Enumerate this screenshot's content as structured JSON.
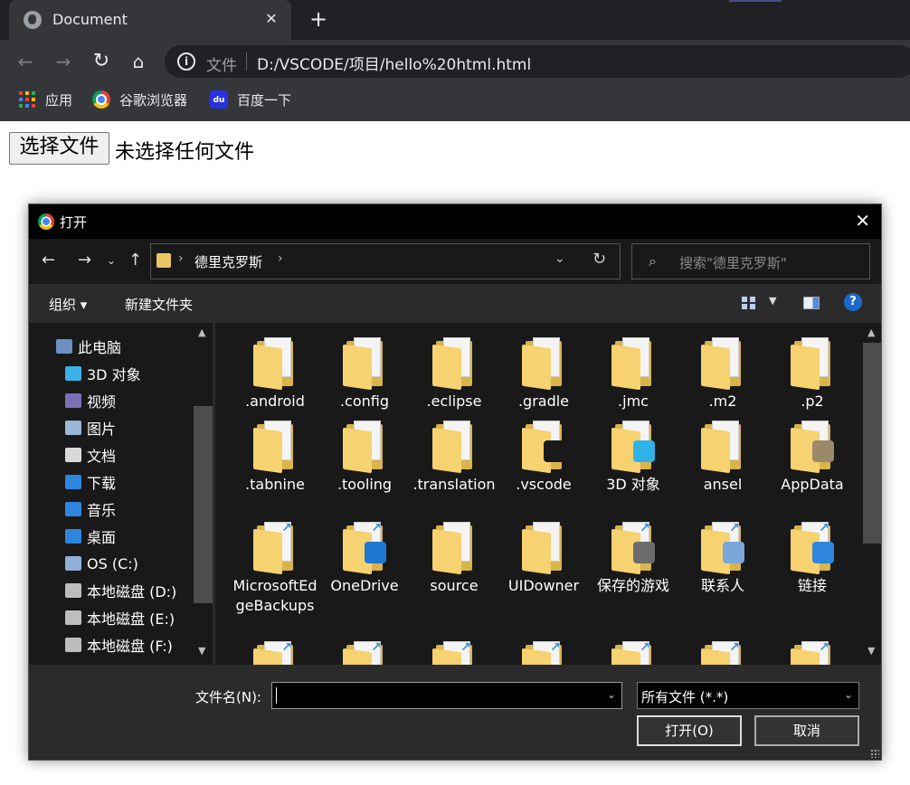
{
  "browser": {
    "tab_title": "Document",
    "tab_close": "✕",
    "new_tab": "+",
    "omnibox": {
      "scheme": "文件",
      "url": "D:/VSCODE/项目/hello%20html.html"
    },
    "bookmarks": [
      {
        "label": "应用",
        "icon": "apps-icon"
      },
      {
        "label": "谷歌浏览器",
        "icon": "chrome-icon"
      },
      {
        "label": "百度一下",
        "icon": "baidu-icon"
      }
    ]
  },
  "page": {
    "file_button": "选择文件",
    "file_status": "未选择任何文件"
  },
  "dialog": {
    "title": "打开",
    "path_crumb": "德里克罗斯",
    "search_placeholder": "搜索\"德里克罗斯\"",
    "organize": "组织 ▾",
    "new_folder": "新建文件夹",
    "help": "?",
    "nav_items": [
      {
        "label": "此电脑",
        "color": "#6b8fc2"
      },
      {
        "label": "3D 对象",
        "color": "#3db2e8"
      },
      {
        "label": "视频",
        "color": "#7b6fb5"
      },
      {
        "label": "图片",
        "color": "#9ab7d6"
      },
      {
        "label": "文档",
        "color": "#d9d9d9"
      },
      {
        "label": "下载",
        "color": "#2e86de"
      },
      {
        "label": "音乐",
        "color": "#2e86de"
      },
      {
        "label": "桌面",
        "color": "#2e86de"
      },
      {
        "label": "OS (C:)",
        "color": "#8fb0d8"
      },
      {
        "label": "本地磁盘 (D:)",
        "color": "#bdbdbd"
      },
      {
        "label": "本地磁盘 (E:)",
        "color": "#bdbdbd"
      },
      {
        "label": "本地磁盘 (F:)",
        "color": "#bdbdbd"
      }
    ],
    "files": [
      {
        "name": ".android"
      },
      {
        "name": ".config"
      },
      {
        "name": ".eclipse"
      },
      {
        "name": ".gradle"
      },
      {
        "name": ".jmc"
      },
      {
        "name": ".m2"
      },
      {
        "name": ".p2"
      },
      {
        "name": ".tabnine"
      },
      {
        "name": ".tooling"
      },
      {
        "name": ".translation"
      },
      {
        "name": ".vscode"
      },
      {
        "name": "3D 对象"
      },
      {
        "name": "ansel"
      },
      {
        "name": "AppData"
      },
      {
        "name": "MicrosoftEdgeBackups"
      },
      {
        "name": "OneDrive"
      },
      {
        "name": "source"
      },
      {
        "name": "UIDowner"
      },
      {
        "name": "保存的游戏"
      },
      {
        "name": "联系人"
      },
      {
        "name": "链接"
      },
      {
        "name": ""
      },
      {
        "name": ""
      },
      {
        "name": ""
      },
      {
        "name": ""
      },
      {
        "name": ""
      },
      {
        "name": ""
      },
      {
        "name": ""
      }
    ],
    "filename_label": "文件名(N):",
    "filename_value": "",
    "filetype_value": "所有文件 (*.*)",
    "open_button": "打开(O)",
    "cancel_button": "取消"
  }
}
